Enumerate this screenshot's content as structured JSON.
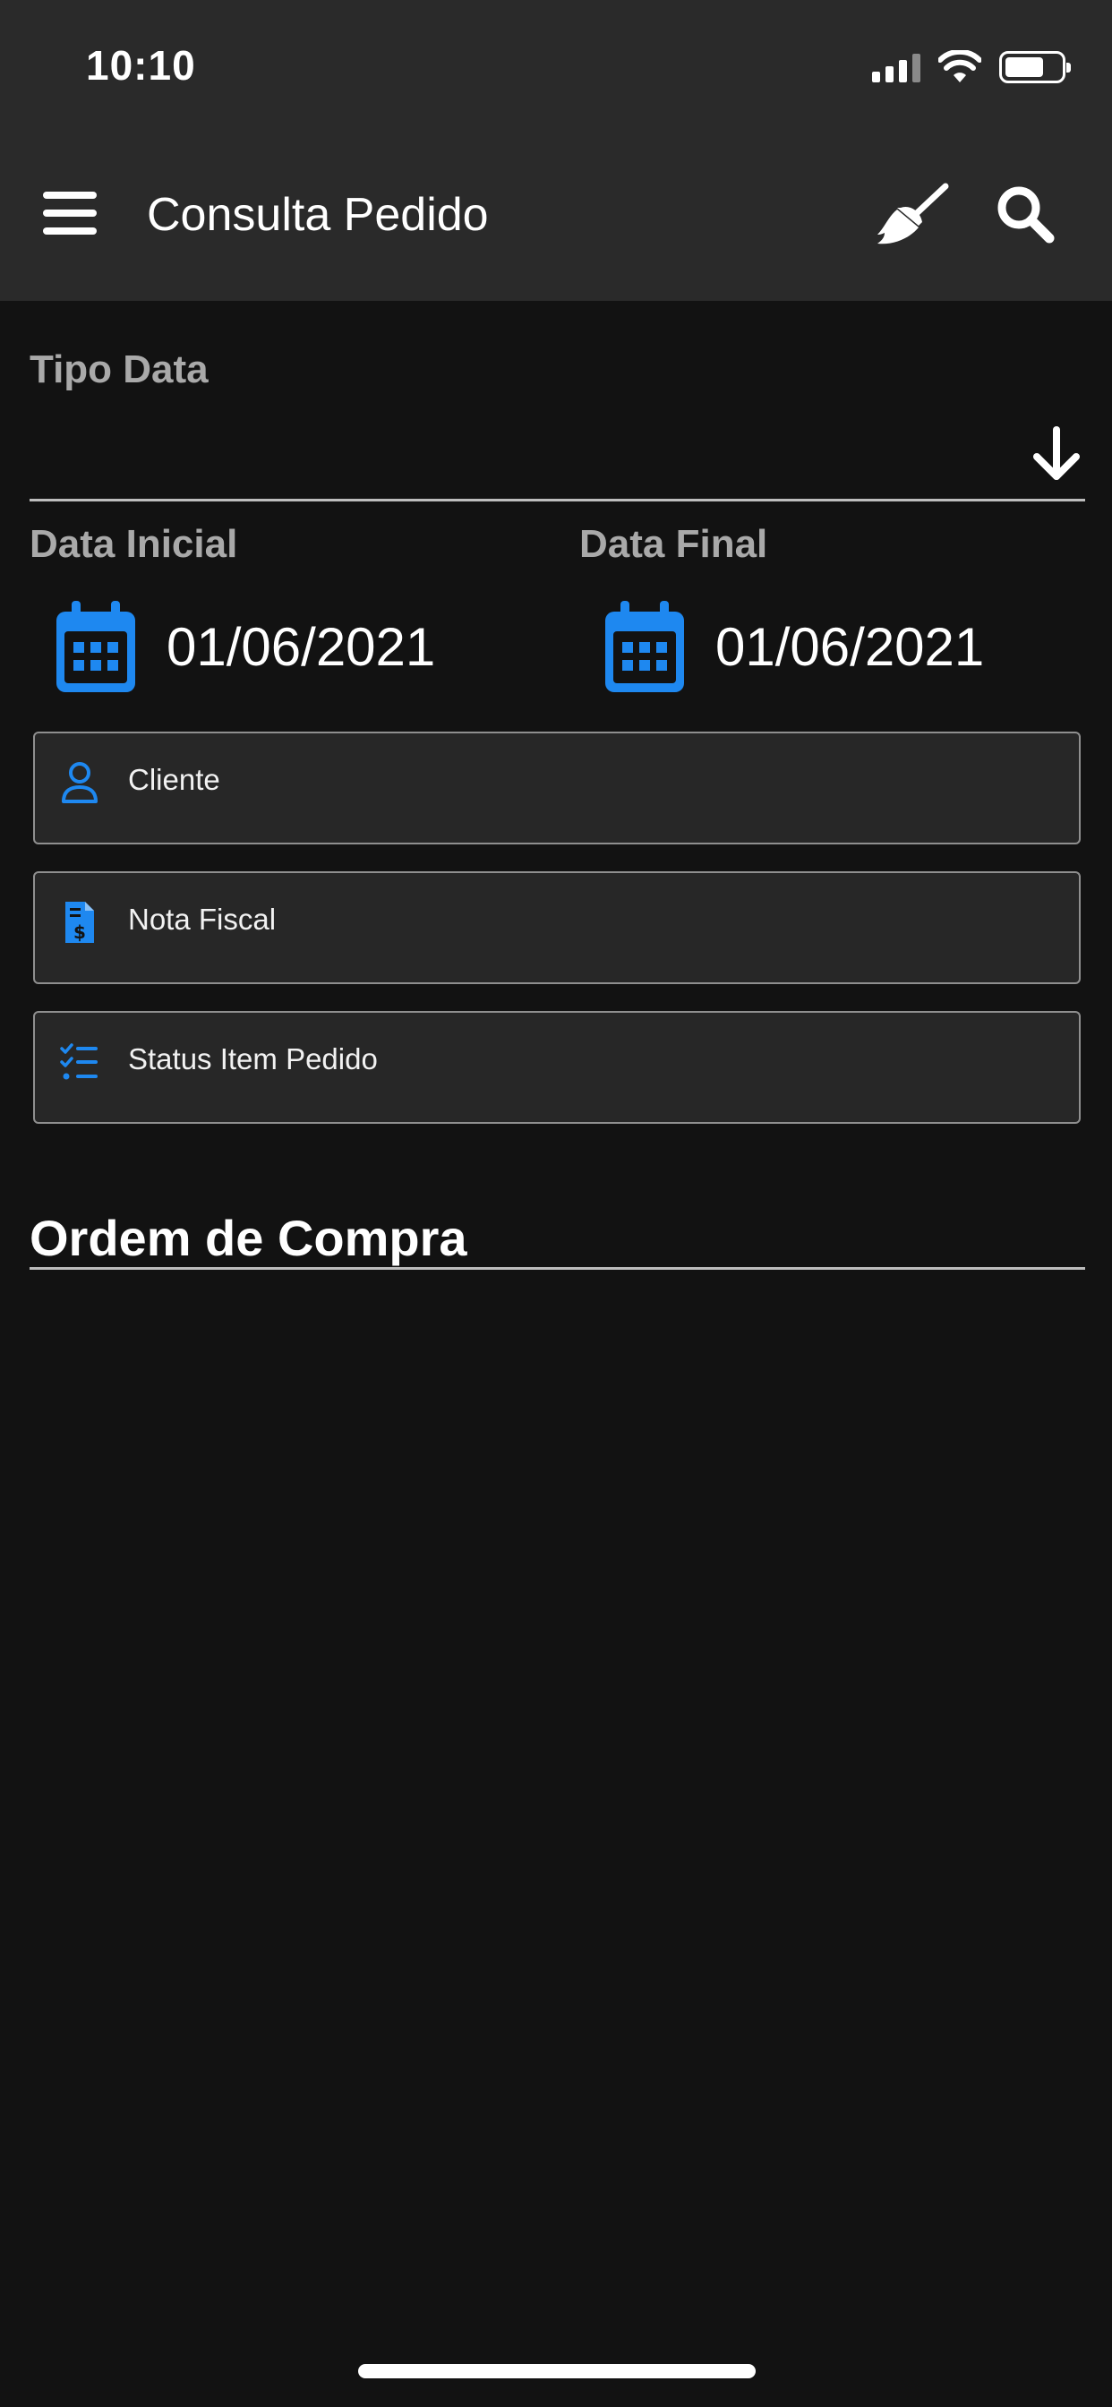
{
  "status_bar": {
    "time": "10:10",
    "signal_icon": "cellular-signal-icon",
    "wifi_icon": "wifi-icon",
    "battery_icon": "battery-icon",
    "battery_level": 0.7
  },
  "app_bar": {
    "title": "Consulta Pedido",
    "menu_icon": "hamburger-menu-icon",
    "clear_icon": "broom-icon",
    "search_icon": "search-icon"
  },
  "tipo_data": {
    "label": "Tipo Data",
    "value": "",
    "dropdown_icon": "arrow-down-icon"
  },
  "dates": {
    "start_label": "Data Inicial",
    "start_value": "01/06/2021",
    "end_label": "Data Final",
    "end_value": "01/06/2021",
    "calendar_icon": "calendar-icon"
  },
  "filters": [
    {
      "label": "Cliente",
      "icon": "person-icon"
    },
    {
      "label": "Nota Fiscal",
      "icon": "invoice-icon"
    },
    {
      "label": "Status Item Pedido",
      "icon": "checklist-icon"
    }
  ],
  "section": {
    "title": "Ordem de Compra"
  },
  "colors": {
    "accent": "#1e88f0",
    "background": "#121212",
    "app_bar": "#2a2a2a",
    "field_bg": "#272727",
    "label_gray": "#a9a9a9"
  }
}
